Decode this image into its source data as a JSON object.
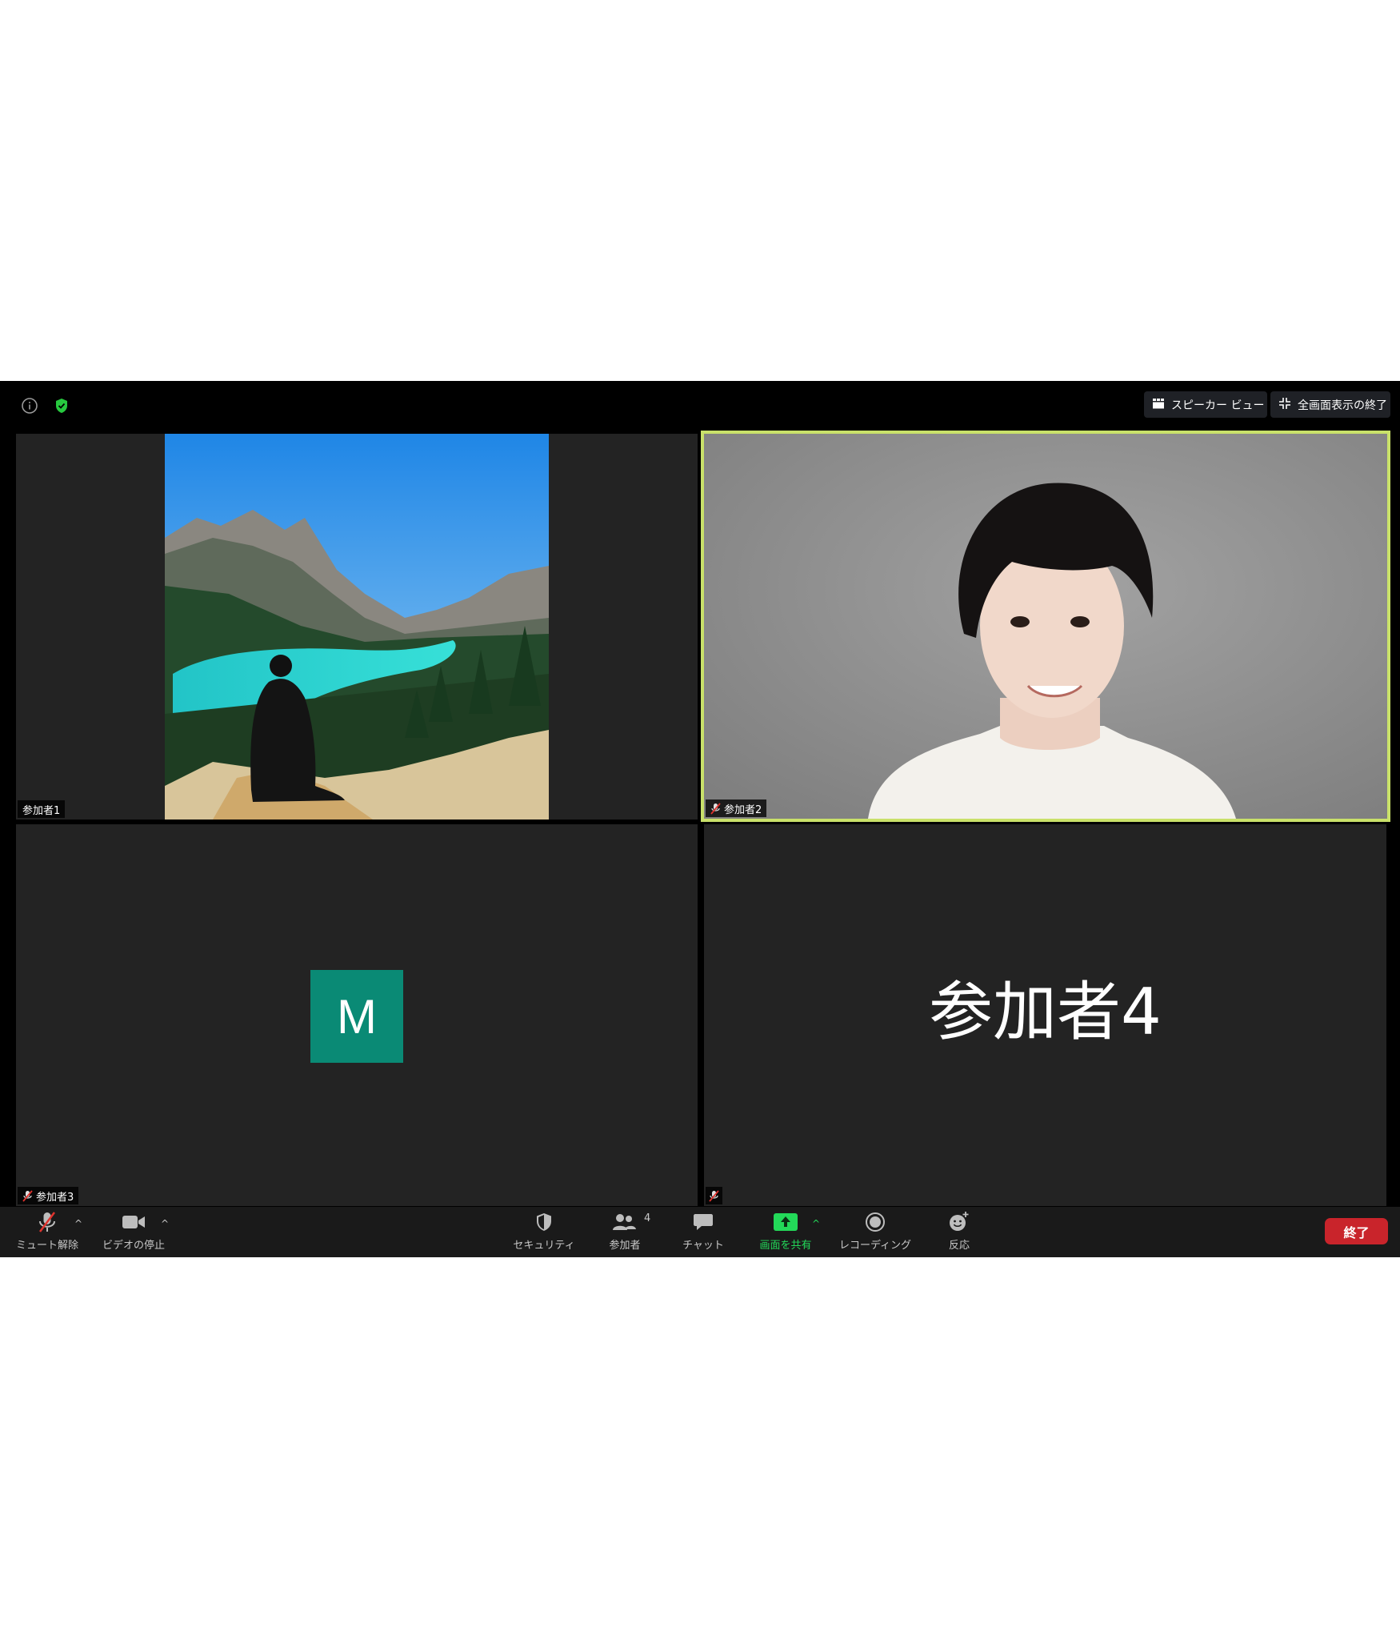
{
  "top_bar": {
    "speaker_view_label": "スピーカー ビュー",
    "exit_fullscreen_label": "全画面表示の終了",
    "info_icon": "info-icon",
    "security_badge_icon": "shield-check-icon",
    "security_badge_color": "#27c93f"
  },
  "participants": [
    {
      "name": "参加者1",
      "video": "landscape-photo",
      "muted": false,
      "active_speaker": false
    },
    {
      "name": "参加者2",
      "video": "portrait-photo",
      "muted": true,
      "active_speaker": true
    },
    {
      "name": "参加者3",
      "avatar_initial": "M",
      "avatar_color": "#0a8a75",
      "muted": true
    },
    {
      "name": "参加者4",
      "display_name_large": "参加者4",
      "muted": true
    }
  ],
  "active_speaker_border_color": "#c9e16a",
  "toolbar": {
    "mute": {
      "label": "ミュート解除",
      "icon": "mic-off-icon"
    },
    "video": {
      "label": "ビデオの停止",
      "icon": "video-camera-icon"
    },
    "security": {
      "label": "セキュリティ",
      "icon": "shield-icon"
    },
    "participants": {
      "label": "参加者",
      "count": "4",
      "icon": "people-icon"
    },
    "chat": {
      "label": "チャット",
      "icon": "chat-bubble-icon"
    },
    "share": {
      "label": "画面を共有",
      "icon": "share-screen-icon",
      "color": "#23d959"
    },
    "record": {
      "label": "レコーディング",
      "icon": "record-icon"
    },
    "reactions": {
      "label": "反応",
      "icon": "emoji-add-icon"
    },
    "end": {
      "label": "終了",
      "color": "#c9242b"
    }
  }
}
